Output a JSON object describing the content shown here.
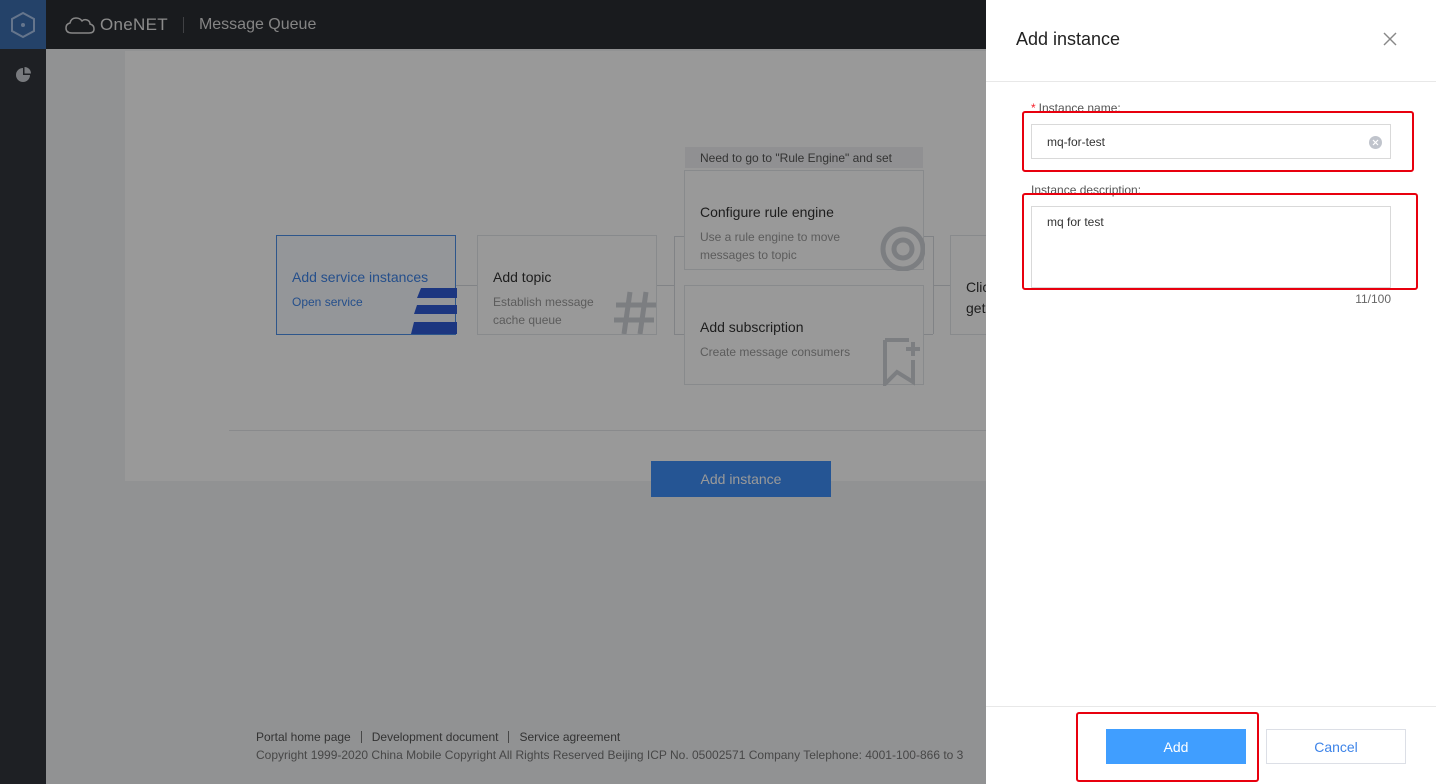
{
  "app": {
    "brand_name": "OneNET",
    "product_name": "Message Queue"
  },
  "steps": {
    "add_service": {
      "title": "Add service instances",
      "subtitle": "Open service"
    },
    "add_topic": {
      "title": "Add topic",
      "subtitle_line1": "Establish message",
      "subtitle_line2": "cache queue"
    },
    "hint": "Need to go to \"Rule Engine\" and set",
    "rule_engine": {
      "title": "Configure rule engine",
      "subtitle_line1": "Use a rule engine to move",
      "subtitle_line2": "messages to topic"
    },
    "add_subscription": {
      "title": "Add subscription",
      "subtitle": "Create message consumers"
    },
    "client": {
      "line1": "Clic",
      "line2": "get"
    }
  },
  "main": {
    "add_instance_label": "Add instance"
  },
  "footer": {
    "links": [
      "Portal home page",
      "Development document",
      "Service agreement"
    ],
    "copyright": "Copyright 1999-2020 China Mobile Copyright All Rights Reserved Beijing ICP No. 05002571 Company Telephone: 4001-100-866 to 3"
  },
  "drawer": {
    "title": "Add instance",
    "name_label": "Instance name:",
    "required_mark": "*",
    "name_value": "mq-for-test",
    "desc_label": "Instance description:",
    "desc_value": "mq for test",
    "counter": "11/100",
    "add_label": "Add",
    "cancel_label": "Cancel"
  },
  "colors": {
    "primary": "#409eff",
    "highlight": "#e8000e",
    "topbar": "#2b2d32",
    "rail": "#33363c"
  }
}
